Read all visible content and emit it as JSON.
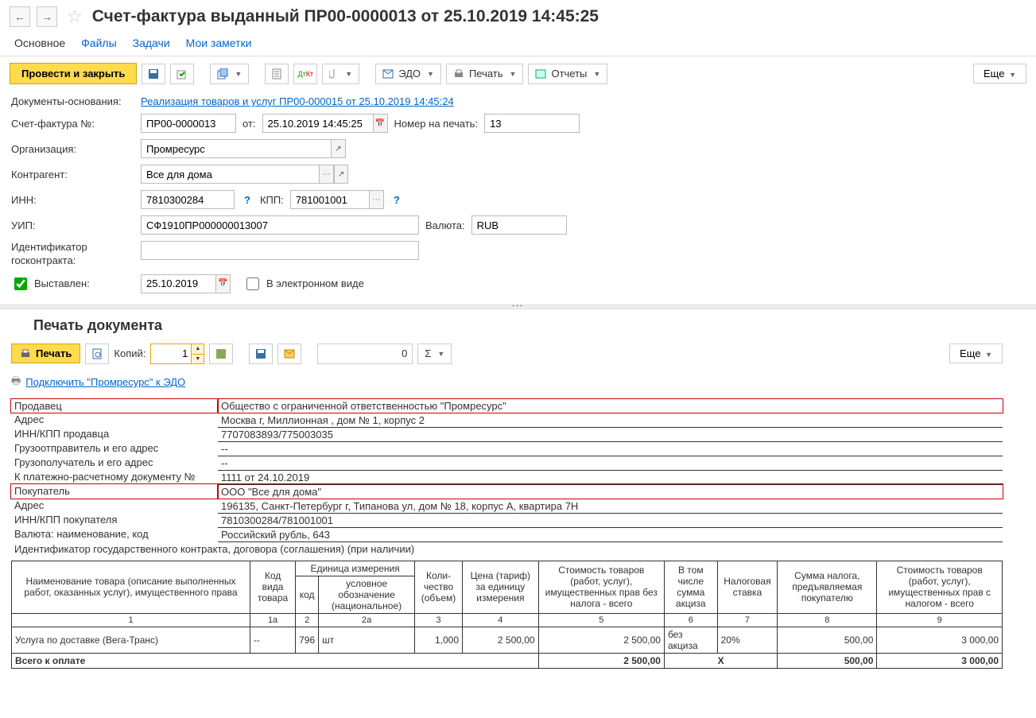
{
  "page_title": "Счет-фактура выданный ПР00-0000013 от 25.10.2019 14:45:25",
  "tabs": {
    "main": "Основное",
    "files": "Файлы",
    "tasks": "Задачи",
    "notes": "Мои заметки"
  },
  "toolbar": {
    "post_close": "Провести и закрыть",
    "edo": "ЭДО",
    "print": "Печать",
    "reports": "Отчеты",
    "more": "Еще"
  },
  "labels": {
    "basis_doc": "Документы-основания:",
    "invoice_no": "Счет-фактура №:",
    "from": "от:",
    "print_number": "Номер на печать:",
    "org": "Организация:",
    "counterparty": "Контрагент:",
    "inn": "ИНН:",
    "kpp": "КПП:",
    "uip": "УИП:",
    "currency": "Валюта:",
    "contract_id": "Идентификатор госконтракта:",
    "issued": "Выставлен:",
    "electronic": "В электронном виде"
  },
  "values": {
    "basis_doc_link": "Реализация товаров и услуг ПР00-000015 от 25.10.2019 14:45:24",
    "invoice_no": "ПР00-0000013",
    "date": "25.10.2019 14:45:25",
    "print_number": "13",
    "org": "Промресурс",
    "counterparty": "Все для дома",
    "inn": "7810300284",
    "kpp": "781001001",
    "uip": "СФ1910ПР000000013007",
    "currency": "RUB",
    "contract_id": "",
    "issued_date": "25.10.2019"
  },
  "print": {
    "title": "Печать документа",
    "print_btn": "Печать",
    "copies_label": "Копий:",
    "copies_value": "1",
    "counter": "0",
    "more": "Еще",
    "edo_link": "Подключить \"Промресурс\" к ЭДО"
  },
  "info_rows": [
    {
      "label": "Продавец",
      "value": "Общество с ограниченной ответственностью \"Промресурс\"",
      "red": true
    },
    {
      "label": "Адрес",
      "value": "Москва г, Миллионная , дом № 1, корпус 2"
    },
    {
      "label": "ИНН/КПП продавца",
      "value": "7707083893/775003035"
    },
    {
      "label": "Грузоотправитель и его адрес",
      "value": "--"
    },
    {
      "label": "Грузополучатель и его адрес",
      "value": "--"
    },
    {
      "label": "К платежно-расчетному документу №",
      "value": "1111 от 24.10.2019"
    },
    {
      "label": "Покупатель",
      "value": "ООО \"Все для дома\"",
      "red": true
    },
    {
      "label": "Адрес",
      "value": "196135, Санкт-Петербург г, Типанова ул, дом № 18, корпус А, квартира 7Н"
    },
    {
      "label": "ИНН/КПП покупателя",
      "value": "7810300284/781001001"
    },
    {
      "label": "Валюта: наименование, код",
      "value": "Российский рубль, 643"
    }
  ],
  "contract_line": "Идентификатор государственного контракта, договора (соглашения) (при наличии)",
  "items_header": {
    "name": "Наименование товара (описание выполненных работ, оказанных услуг), имущественного права",
    "type_code": "Код вида товара",
    "unit": "Единица измерения",
    "unit_code": "код",
    "unit_name": "условное обозначение (национальное)",
    "qty": "Коли-\nчество (объем)",
    "price": "Цена (тариф) за единицу измерения",
    "cost_no_tax": "Стоимость товаров (работ, услуг), имущественных прав без налога - всего",
    "excise": "В том числе сумма акциза",
    "tax_rate": "Налоговая ставка",
    "tax_sum": "Сумма налога, предъявляемая покупателю",
    "cost_with_tax": "Стоимость товаров (работ, услуг), имущественных прав с налогом - всего"
  },
  "col_numbers": [
    "1",
    "1а",
    "2",
    "2а",
    "3",
    "4",
    "5",
    "6",
    "7",
    "8",
    "9"
  ],
  "item_row": {
    "name": "Услуга по доставке (Вега-Транс)",
    "type_code": "--",
    "unit_code": "796",
    "unit_name": "шт",
    "qty": "1,000",
    "price": "2 500,00",
    "cost_no_tax": "2 500,00",
    "excise": "без акциза",
    "tax_rate": "20%",
    "tax_sum": "500,00",
    "cost_with_tax": "3 000,00"
  },
  "total": {
    "label": "Всего к оплате",
    "cost_no_tax": "2 500,00",
    "x": "X",
    "tax_sum": "500,00",
    "cost_with_tax": "3 000,00"
  }
}
